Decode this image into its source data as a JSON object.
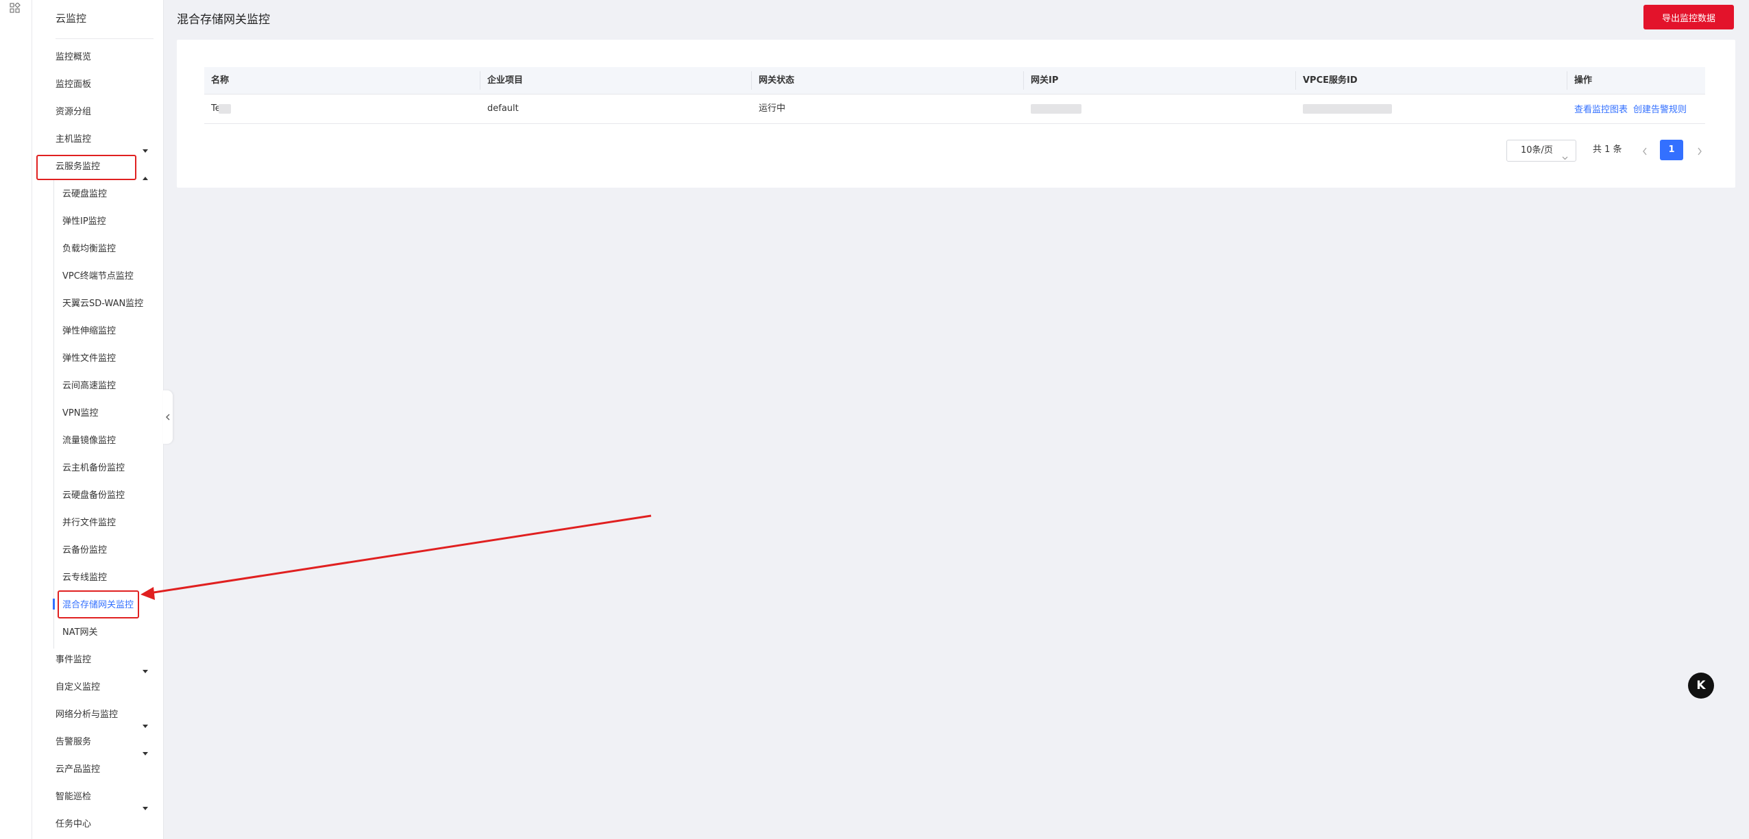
{
  "sidebar": {
    "title": "云监控",
    "items": [
      {
        "label": "监控概览"
      },
      {
        "label": "监控面板"
      },
      {
        "label": "资源分组"
      },
      {
        "label": "主机监控"
      },
      {
        "label": "云服务监控"
      },
      {
        "label": "事件监控"
      },
      {
        "label": "自定义监控"
      },
      {
        "label": "网络分析与监控"
      },
      {
        "label": "告警服务"
      },
      {
        "label": "云产品监控"
      },
      {
        "label": "智能巡检"
      },
      {
        "label": "任务中心"
      }
    ],
    "sub_items": [
      {
        "label": "云硬盘监控"
      },
      {
        "label": "弹性IP监控"
      },
      {
        "label": "负载均衡监控"
      },
      {
        "label": "VPC终端节点监控"
      },
      {
        "label": "天翼云SD-WAN监控"
      },
      {
        "label": "弹性伸缩监控"
      },
      {
        "label": "弹性文件监控"
      },
      {
        "label": "云间高速监控"
      },
      {
        "label": "VPN监控"
      },
      {
        "label": "流量镜像监控"
      },
      {
        "label": "云主机备份监控"
      },
      {
        "label": "云硬盘备份监控"
      },
      {
        "label": "并行文件监控"
      },
      {
        "label": "云备份监控"
      },
      {
        "label": "云专线监控"
      },
      {
        "label": "混合存储网关监控"
      },
      {
        "label": "NAT网关"
      }
    ]
  },
  "header": {
    "title": "混合存储网关监控",
    "export_label": "导出监控数据"
  },
  "table": {
    "columns": [
      "名称",
      "企业项目",
      "网关状态",
      "网关IP",
      "VPCE服务ID",
      "操作"
    ],
    "rows": [
      {
        "name": "Te",
        "project": "default",
        "status": "运行中",
        "ops": [
          "查看监控图表",
          "创建告警规则"
        ]
      }
    ]
  },
  "pagination": {
    "page_size": "10条/页",
    "total": "共 1 条",
    "current": "1"
  },
  "float_button": {
    "label": "K"
  },
  "colors": {
    "accent": "#3370ff",
    "brand_red": "#e3132b",
    "annotation_red": "#e02020",
    "background": "#f0f1f5"
  }
}
